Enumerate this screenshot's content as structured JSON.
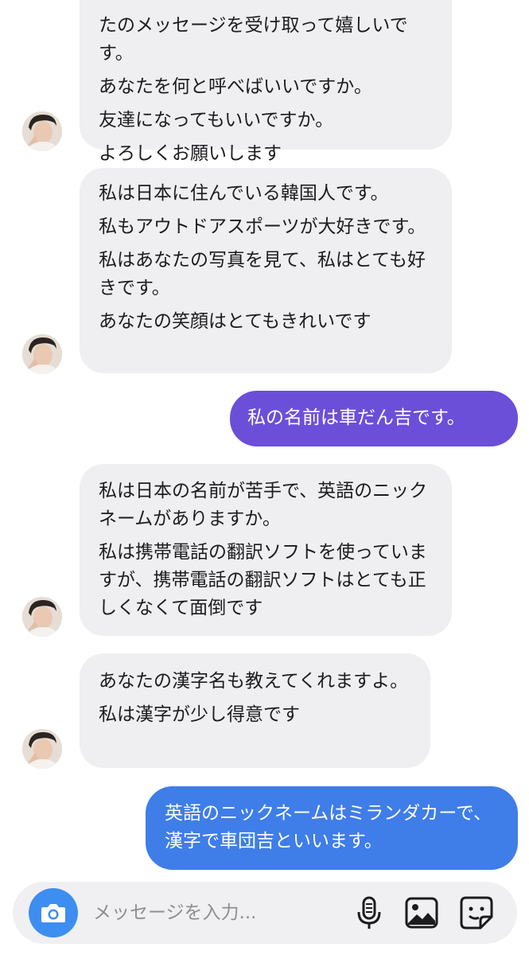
{
  "messages": [
    {
      "side": "in",
      "lines": [
        "たのメッセージを受け取って嬉しいです。",
        "あなたを何と呼べばいいですか。",
        "友達になってもいいですか。",
        "よろしくお願いします"
      ]
    },
    {
      "side": "in",
      "lines": [
        "私は日本に住んでいる韓国人です。",
        "私もアウトドアスポーツが大好きです。",
        "私はあなたの写真を見て、私はとても好きです。",
        "あなたの笑顔はとてもきれいです"
      ]
    },
    {
      "side": "out",
      "lines": [
        "私の名前は車だん吉です。"
      ]
    },
    {
      "side": "in",
      "lines": [
        "私は日本の名前が苦手で、英語のニックネームがありますか。",
        "私は携帯電話の翻訳ソフトを使っていますが、携帯電話の翻訳ソフトはとても正しくなくて面倒です"
      ]
    },
    {
      "side": "in",
      "lines": [
        "あなたの漢字名も教えてくれますよ。",
        "私は漢字が少し得意です"
      ]
    },
    {
      "side": "out",
      "lines": [
        "英語のニックネームはミランダカーで、漢字で車団吉といいます。"
      ]
    }
  ],
  "composer": {
    "placeholder": "メッセージを入力...",
    "camera_icon": "camera-icon",
    "mic_icon": "microphone-icon",
    "gallery_icon": "image-gallery-icon",
    "sticker_icon": "sticker-icon"
  },
  "colors": {
    "incoming_bubble": "#efeff1",
    "outgoing_purple": "#6b4fd8",
    "outgoing_blue": "#3f7de8",
    "camera_button": "#3d8ef0"
  }
}
